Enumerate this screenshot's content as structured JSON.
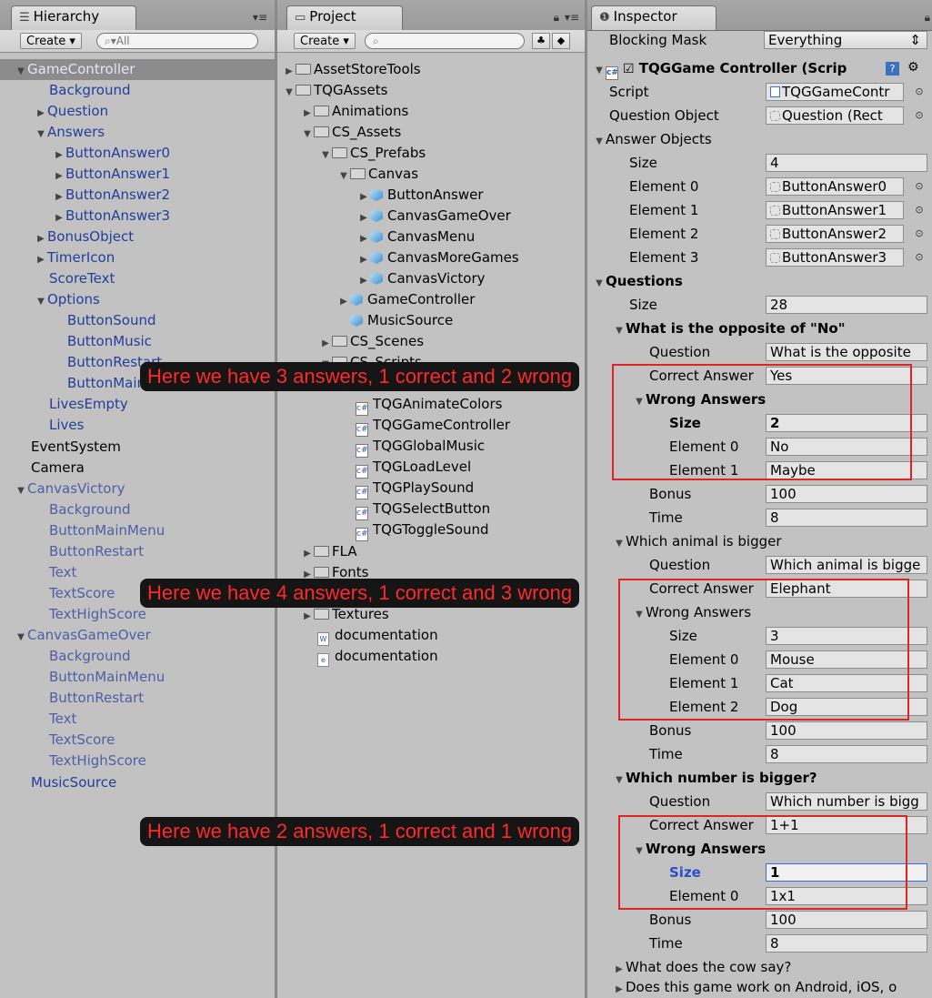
{
  "hierarchy": {
    "tab_label": "Hierarchy",
    "create_label": "Create",
    "search_placeholder": "All",
    "items": [
      {
        "label": "GameController"
      },
      {
        "label": "Background"
      },
      {
        "label": "Question"
      },
      {
        "label": "Answers"
      },
      {
        "label": "ButtonAnswer0"
      },
      {
        "label": "ButtonAnswer1"
      },
      {
        "label": "ButtonAnswer2"
      },
      {
        "label": "ButtonAnswer3"
      },
      {
        "label": "BonusObject"
      },
      {
        "label": "TimerIcon"
      },
      {
        "label": "ScoreText"
      },
      {
        "label": "Options"
      },
      {
        "label": "ButtonSound"
      },
      {
        "label": "ButtonMusic"
      },
      {
        "label": "ButtonRestart"
      },
      {
        "label": "ButtonMainMenu"
      },
      {
        "label": "LivesEmpty"
      },
      {
        "label": "Lives"
      },
      {
        "label": "EventSystem"
      },
      {
        "label": "Camera"
      },
      {
        "label": "CanvasVictory"
      },
      {
        "label": "Background"
      },
      {
        "label": "ButtonMainMenu"
      },
      {
        "label": "ButtonRestart"
      },
      {
        "label": "Text"
      },
      {
        "label": "TextScore"
      },
      {
        "label": "TextHighScore"
      },
      {
        "label": "CanvasGameOver"
      },
      {
        "label": "Background"
      },
      {
        "label": "ButtonMainMenu"
      },
      {
        "label": "ButtonRestart"
      },
      {
        "label": "Text"
      },
      {
        "label": "TextScore"
      },
      {
        "label": "TextHighScore"
      },
      {
        "label": "MusicSource"
      }
    ]
  },
  "project": {
    "tab_label": "Project",
    "create_label": "Create",
    "items": [
      {
        "label": "AssetStoreTools"
      },
      {
        "label": "TQGAssets"
      },
      {
        "label": "Animations"
      },
      {
        "label": "CS_Assets"
      },
      {
        "label": "CS_Prefabs"
      },
      {
        "label": "Canvas"
      },
      {
        "label": "ButtonAnswer"
      },
      {
        "label": "CanvasGameOver"
      },
      {
        "label": "CanvasMenu"
      },
      {
        "label": "CanvasMoreGames"
      },
      {
        "label": "CanvasVictory"
      },
      {
        "label": "GameController"
      },
      {
        "label": "MusicSource"
      },
      {
        "label": "CS_Scenes"
      },
      {
        "label": "CS_Scripts"
      },
      {
        "label": "TQGAnimateColors"
      },
      {
        "label": "TQGGameController"
      },
      {
        "label": "TQGGlobalMusic"
      },
      {
        "label": "TQGLoadLevel"
      },
      {
        "label": "TQGPlaySound"
      },
      {
        "label": "TQGSelectButton"
      },
      {
        "label": "TQGToggleSound"
      },
      {
        "label": "FLA"
      },
      {
        "label": "Fonts"
      },
      {
        "label": "Textures"
      },
      {
        "label": "documentation"
      },
      {
        "label": "documentation"
      }
    ]
  },
  "inspector": {
    "tab_label": "Inspector",
    "blocking_mask_label": "Blocking Mask",
    "blocking_mask_value": "Everything",
    "component_title": "TQGGame Controller (Scrip",
    "script_label": "Script",
    "script_value": "TQGGameContr",
    "question_object_label": "Question Object",
    "question_object_value": "Question (Rect",
    "answer_objects_label": "Answer Objects",
    "answer_size_label": "Size",
    "answer_size_value": "4",
    "answer_elements": [
      {
        "label": "Element 0",
        "value": "ButtonAnswer0"
      },
      {
        "label": "Element 1",
        "value": "ButtonAnswer1"
      },
      {
        "label": "Element 2",
        "value": "ButtonAnswer2"
      },
      {
        "label": "Element 3",
        "value": "ButtonAnswer3"
      }
    ],
    "questions_label": "Questions",
    "questions_size_label": "Size",
    "questions_size_value": "28",
    "q1": {
      "header": "What is the opposite of \"No\"",
      "question_label": "Question",
      "question_value": "What is the opposite",
      "correct_label": "Correct Answer",
      "correct_value": "Yes",
      "wrong_label": "Wrong Answers",
      "size_label": "Size",
      "size_value": "2",
      "elements": [
        {
          "label": "Element 0",
          "value": "No"
        },
        {
          "label": "Element 1",
          "value": "Maybe"
        }
      ],
      "bonus_label": "Bonus",
      "bonus_value": "100",
      "time_label": "Time",
      "time_value": "8"
    },
    "q2": {
      "header": "Which animal is bigger",
      "question_label": "Question",
      "question_value": "Which animal is bigge",
      "correct_label": "Correct Answer",
      "correct_value": "Elephant",
      "wrong_label": "Wrong Answers",
      "size_label": "Size",
      "size_value": "3",
      "elements": [
        {
          "label": "Element 0",
          "value": "Mouse"
        },
        {
          "label": "Element 1",
          "value": "Cat"
        },
        {
          "label": "Element 2",
          "value": "Dog"
        }
      ],
      "bonus_label": "Bonus",
      "bonus_value": "100",
      "time_label": "Time",
      "time_value": "8"
    },
    "q3": {
      "header": "Which number is bigger?",
      "question_label": "Question",
      "question_value": "Which number is bigg",
      "correct_label": "Correct Answer",
      "correct_value": "1+1",
      "wrong_label": "Wrong Answers",
      "size_label": "Size",
      "size_value": "1",
      "elements": [
        {
          "label": "Element 0",
          "value": "1x1"
        }
      ],
      "bonus_label": "Bonus",
      "bonus_value": "100",
      "time_label": "Time",
      "time_value": "8"
    },
    "q4_header": "What does the cow say?",
    "q5_header": "Does this game work on Android, iOS, o"
  },
  "annotations": [
    "Here we have 3 answers, 1 correct and 2 wrong",
    "Here we have 4 answers, 1 correct and 3 wrong",
    "Here we have 2 answers, 1 correct and 1 wrong"
  ],
  "colors": {
    "annotation_text": "#ff2a2a",
    "annotation_bg": "#151515",
    "highlight_box": "#e02424",
    "prefab_blue": "#233d9b",
    "selected_field_border": "#3a6fd8"
  }
}
